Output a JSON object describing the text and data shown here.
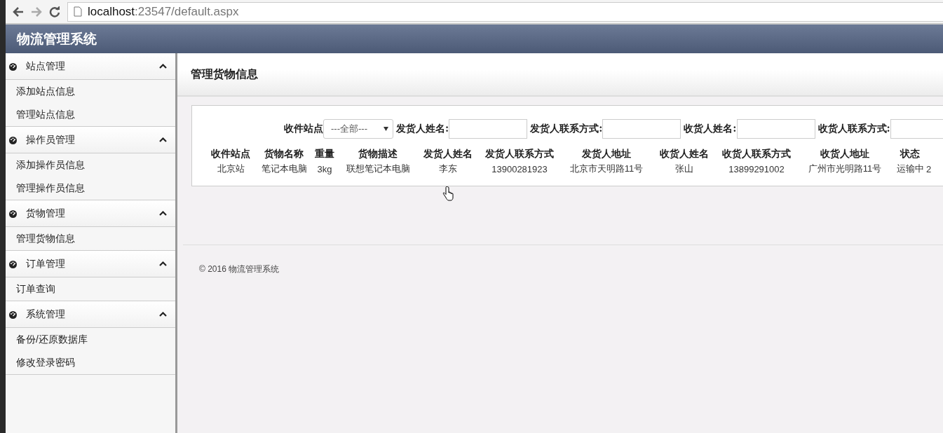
{
  "browser": {
    "host": "localhost",
    "path": ":23547/default.aspx"
  },
  "app": {
    "title": "物流管理系统"
  },
  "sidebar": {
    "groups": [
      {
        "label": "站点管理",
        "expanded": true,
        "items": [
          "添加站点信息",
          "管理站点信息"
        ]
      },
      {
        "label": "操作员管理",
        "expanded": true,
        "items": [
          "添加操作员信息",
          "管理操作员信息"
        ]
      },
      {
        "label": "货物管理",
        "expanded": true,
        "items": [
          "管理货物信息"
        ]
      },
      {
        "label": "订单管理",
        "expanded": true,
        "items": [
          "订单查询"
        ]
      },
      {
        "label": "系统管理",
        "expanded": true,
        "items": [
          "备份/还原数据库",
          "修改登录密码"
        ]
      }
    ]
  },
  "page": {
    "title": "管理货物信息"
  },
  "filters": [
    {
      "kind": "select",
      "label": "收件站点",
      "value": "---全部---"
    },
    {
      "kind": "text",
      "label": "发货人姓名:"
    },
    {
      "kind": "text",
      "label": "发货人联系方式:"
    },
    {
      "kind": "text",
      "label": "收货人姓名:"
    },
    {
      "kind": "text",
      "label": "收货人联系方式:"
    }
  ],
  "table": {
    "columns": [
      "收件站点",
      "货物名称",
      "重量",
      "货物描述",
      "发货人姓名",
      "发货人联系方式",
      "发货人地址",
      "收货人姓名",
      "收货人联系方式",
      "收货人地址",
      "状态"
    ],
    "rows": [
      {
        "cells": [
          "北京站",
          "笔记本电脑",
          "3kg",
          "联想笔记本电脑",
          "李东",
          "13900281923",
          "北京市天明路11号",
          "张山",
          "13899291002",
          "广州市光明路11号",
          "运输中",
          "2"
        ]
      }
    ]
  },
  "footer": "© 2016 物流管理系统"
}
